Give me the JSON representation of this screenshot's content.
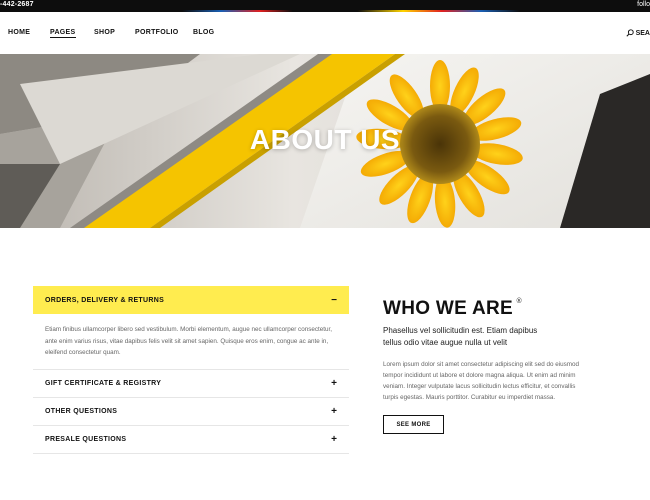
{
  "topbar": {
    "phone": "-442-2687",
    "follow": "follo"
  },
  "nav": {
    "items": [
      "HOME",
      "PAGES",
      "SHOP",
      "PORTFOLIO",
      "BLOG"
    ],
    "active": "PAGES",
    "search_label": "SEA"
  },
  "hero": {
    "title": "ABOUT US"
  },
  "accordion": {
    "items": [
      {
        "title": "ORDERS, DELIVERY & RETURNS",
        "icon": "−",
        "open": true,
        "content": "Etiam finibus ullamcorper libero sed vestibulum. Morbi elementum, augue nec ullamcorper consectetur, ante enim varius risus, vitae dapibus felis velit sit amet sapien. Quisque eros enim, congue ac ante in, eleifend consectetur quam."
      },
      {
        "title": "GIFT CERTIFICATE & REGISTRY",
        "icon": "+",
        "open": false
      },
      {
        "title": "OTHER QUESTIONS",
        "icon": "+",
        "open": false
      },
      {
        "title": "PRESALE QUESTIONS",
        "icon": "+",
        "open": false
      }
    ]
  },
  "who": {
    "title": "WHO WE ARE",
    "mark": "®",
    "subtitle": "Phasellus vel sollicitudin est. Etiam dapibus tellus odio vitae augue nulla ut velit",
    "body": "Lorem ipsum dolor sit amet consectetur adipiscing elit sed do eiusmod tempor incididunt ut labore et dolore magna aliqua. Ut enim ad minim veniam. Integer vulputate lacus sollicitudin lectus efficitur, et convallis turpis egestas. Mauris porttitor. Curabitur eu imperdiet massa.",
    "button": "SEE MORE"
  },
  "colors": {
    "accent": "#ffec4f",
    "hero_yellow": "#f5c400",
    "topbar": "#0d0d0d"
  }
}
